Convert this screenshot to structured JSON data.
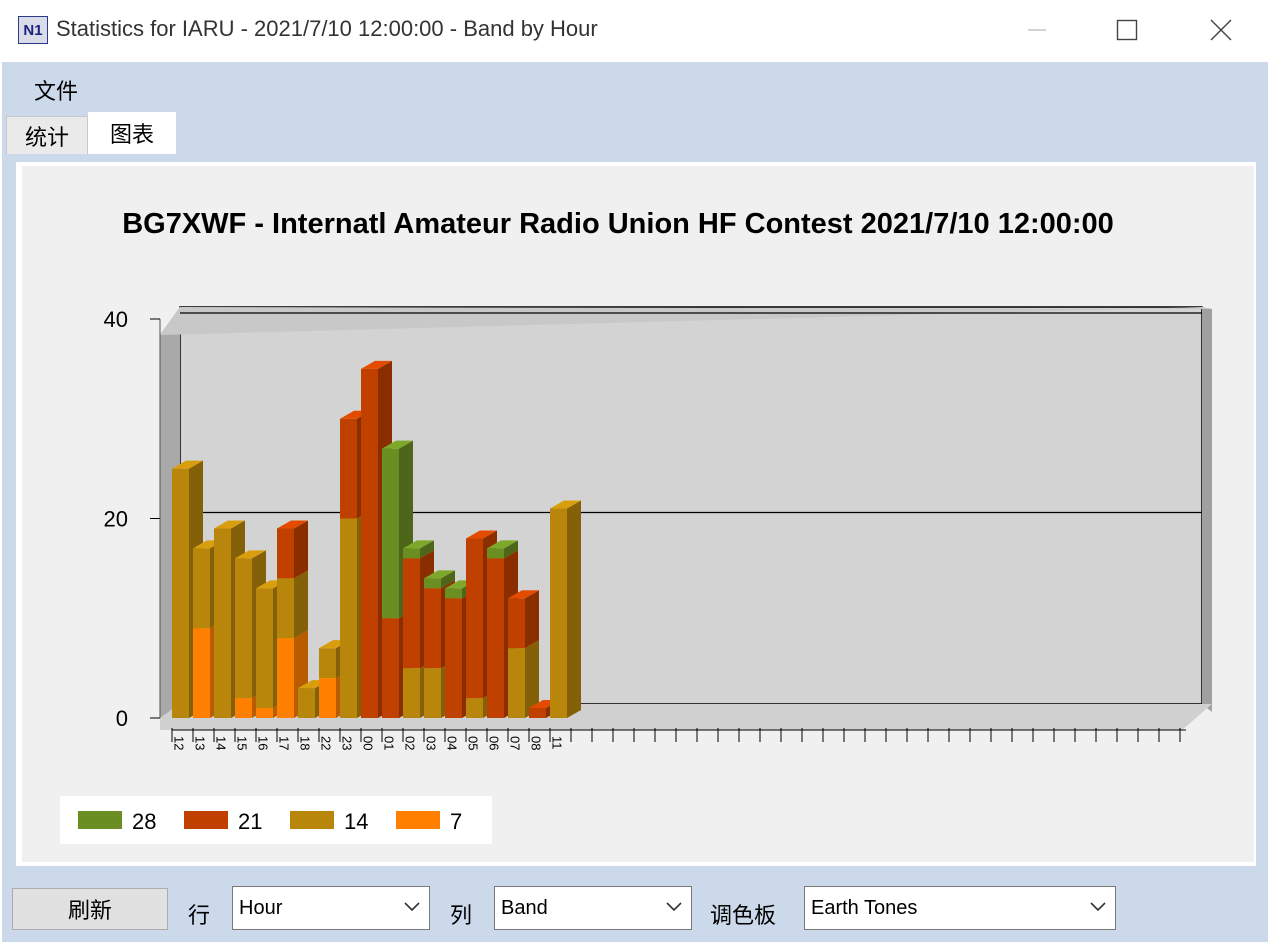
{
  "window": {
    "title": "Statistics for IARU - 2021/7/10 12:00:00 - Band by Hour",
    "icon_name": "n1mm-app-icon",
    "icon_text": "N1"
  },
  "menu": {
    "file": "文件"
  },
  "tabs": [
    {
      "label": "统计",
      "active": false
    },
    {
      "label": "图表",
      "active": true
    }
  ],
  "toolbar": {
    "refresh": "刷新",
    "row_label": "行",
    "row_value": "Hour",
    "col_label": "列",
    "col_value": "Band",
    "palette_label": "调色板",
    "palette_value": "Earth Tones"
  },
  "chart_data": {
    "type": "bar",
    "stacked": true,
    "title": "BG7XWF - Internatl Amateur Radio Union HF Contest 2021/7/10 12:00:00",
    "ylim": [
      0,
      40
    ],
    "yticks": [
      0,
      20,
      40
    ],
    "grid": true,
    "legend_position": "bottom-left",
    "categories": [
      "12",
      "13",
      "14",
      "15",
      "16",
      "17",
      "18",
      "22",
      "23",
      "00",
      "01",
      "02",
      "03",
      "04",
      "05",
      "06",
      "07",
      "08",
      "11"
    ],
    "series": [
      {
        "name": "7",
        "color": "#ff8000",
        "values": [
          0,
          9,
          0,
          2,
          1,
          8,
          0,
          4,
          0,
          0,
          0,
          0,
          0,
          0,
          0,
          0,
          0,
          0,
          0
        ]
      },
      {
        "name": "14",
        "color": "#b8860b",
        "values": [
          25,
          8,
          19,
          14,
          12,
          6,
          3,
          3,
          20,
          0,
          0,
          5,
          5,
          0,
          2,
          0,
          7,
          0,
          21
        ]
      },
      {
        "name": "21",
        "color": "#c04000",
        "values": [
          0,
          0,
          0,
          0,
          0,
          5,
          0,
          0,
          10,
          35,
          10,
          11,
          8,
          12,
          16,
          16,
          5,
          1,
          0
        ]
      },
      {
        "name": "28",
        "color": "#6b8e23",
        "values": [
          0,
          0,
          0,
          0,
          0,
          0,
          0,
          0,
          0,
          0,
          17,
          1,
          1,
          1,
          0,
          1,
          0,
          0,
          0
        ]
      }
    ],
    "legend_order": [
      "28",
      "21",
      "14",
      "7"
    ]
  }
}
